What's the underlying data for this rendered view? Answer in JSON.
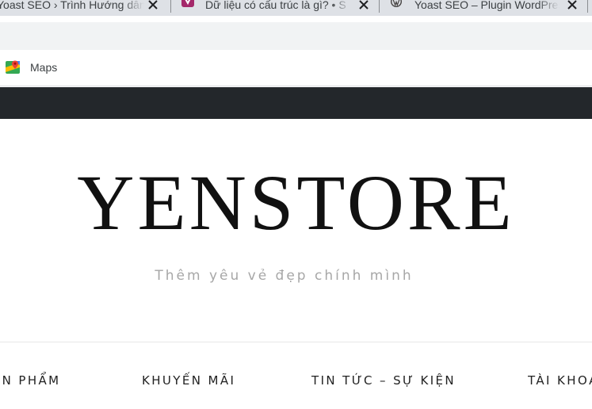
{
  "browser": {
    "tabs": [
      {
        "title": "Yoast SEO › Trình Hướng dẫn",
        "icon": "yoast-icon"
      },
      {
        "title": "Dữ liệu có cấu trúc là gì? • S",
        "icon": "yoast-logo-icon"
      },
      {
        "title": "Yoast SEO – Plugin WordPress",
        "icon": "wordpress-icon"
      }
    ],
    "bookmarks": [
      {
        "label": "Maps",
        "icon": "google-maps-icon"
      }
    ]
  },
  "site": {
    "logo": "YENSTORE",
    "tagline": "Thêm yêu vẻ đẹp chính mình",
    "nav": [
      {
        "label": "SẢN PHẨM"
      },
      {
        "label": "KHUYẾN MÃI"
      },
      {
        "label": "TIN TỨC – SỰ KIỆN"
      },
      {
        "label": "TÀI KHOẢN"
      }
    ]
  },
  "colors": {
    "tabstrip": "#dee1e6",
    "toolbar": "#f1f3f4",
    "top_bar": "#23272b",
    "logo": "#111111",
    "tagline": "#a7a7a7"
  }
}
